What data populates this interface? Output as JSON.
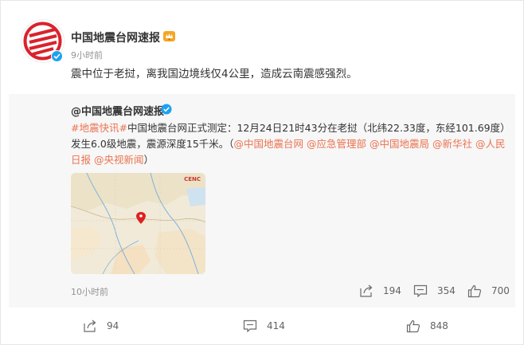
{
  "post": {
    "author": "中国地震台网速报",
    "time": "9小时前",
    "text": "震中位于老挝，离我国边境线仅4公里，造成云南震感强烈。"
  },
  "repost": {
    "author": "@中国地震台网速报",
    "text_parts": {
      "tag1": "#地震快讯#",
      "body": "中国地震台网正式测定：12月24日21时43分在老挝（北纬22.33度，东经101.69度）发生6.0级地震，震源深度15千米。（",
      "mention1": "@中国地震台网",
      "mention2": "@应急管理部",
      "mention3": "@中国地震局",
      "mention4": "@新华社",
      "mention5": "@人民日报",
      "mention6": "@央视新闻",
      "close": "）"
    },
    "map_logo": "CENC",
    "time": "10小时前",
    "reposts": "194",
    "comments": "354",
    "likes": "700"
  },
  "footer": {
    "reposts": "94",
    "comments": "414",
    "likes": "848"
  },
  "colors": {
    "accent": "#eb7350",
    "verified": "#1da1f2",
    "brand_red": "#d9232d"
  }
}
